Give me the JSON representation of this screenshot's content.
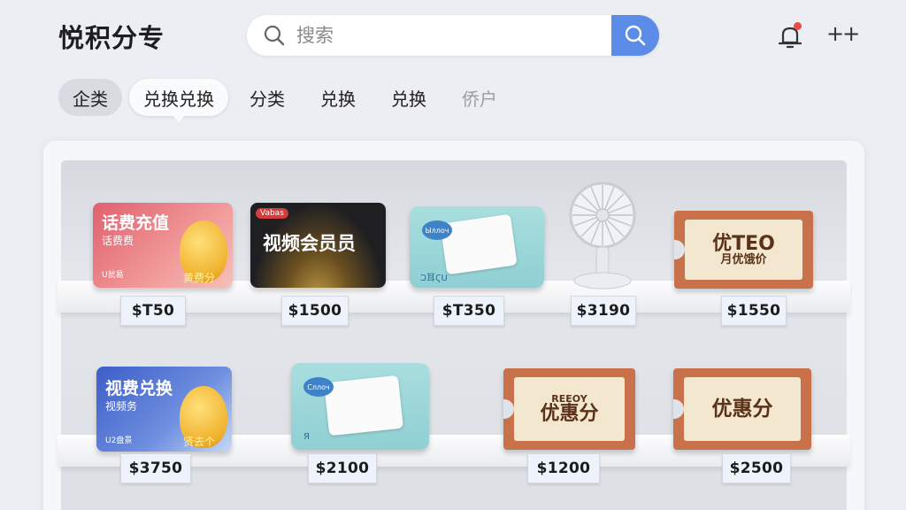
{
  "header": {
    "app_title": "悦积分专",
    "search_placeholder": "搜索"
  },
  "tabs": [
    {
      "label": "企类"
    },
    {
      "label": "兑换兑换"
    },
    {
      "label": "分类"
    },
    {
      "label": "兑换"
    },
    {
      "label": "兑换"
    },
    {
      "label": "侨户"
    }
  ],
  "shelf_top": {
    "items": [
      {
        "title": "话费充值",
        "subtitle": "话费费",
        "badge": "黄费分",
        "corner": "U瓮易",
        "price": "$T50"
      },
      {
        "title": "视频会员员",
        "logo": "Vabas",
        "price": "$1500"
      },
      {
        "brand": "Ыллоч",
        "label": "Ͻ耳ϚU",
        "price": "$T350"
      },
      {
        "price": "$3190"
      },
      {
        "title": "优TEO",
        "subtitle": "月优饿价",
        "price": "$1550"
      }
    ]
  },
  "shelf_bottom": {
    "items": [
      {
        "title": "视费兑换",
        "subtitle": "视频务",
        "badge": "贤去个",
        "corner": "U2盘景",
        "price": "$3750"
      },
      {
        "brand": "Сллоч",
        "label": "Я",
        "price": "$2100"
      },
      {
        "title": "优惠分",
        "subtitle": "REEOY",
        "price": "$1200"
      },
      {
        "title": "优惠分",
        "price": "$2500"
      }
    ]
  },
  "colors": {
    "accent": "#5b8de8",
    "notification_dot": "#ef4a4a",
    "card_red": "#e0606e",
    "card_blue": "#3c5ec8",
    "card_black": "#1f1f22",
    "coupon": "#c8714a"
  }
}
